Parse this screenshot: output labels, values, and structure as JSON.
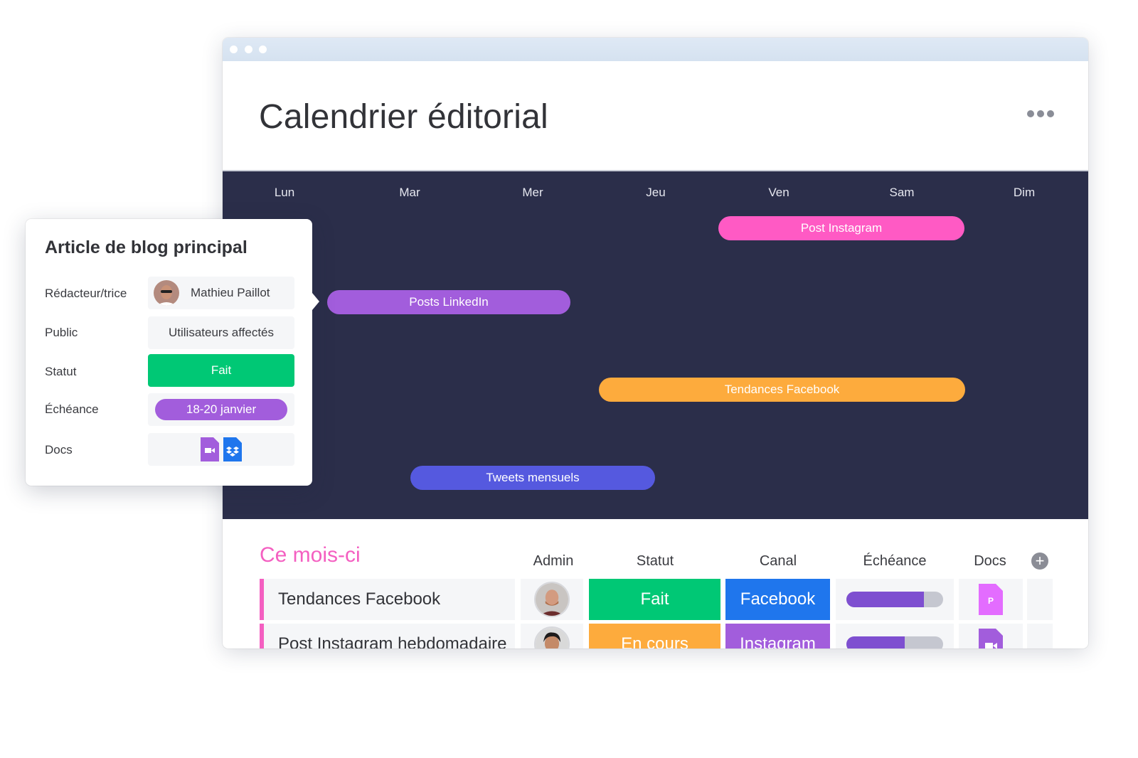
{
  "window": {
    "title": "Calendrier éditorial",
    "more_icon": "more-horizontal-icon"
  },
  "calendar": {
    "days": [
      "Lun",
      "Mar",
      "Mer",
      "Jeu",
      "Ven",
      "Sam",
      "Dim"
    ],
    "events": [
      {
        "label": "Post Instagram",
        "color": "#ff5ac4"
      },
      {
        "label": "Posts LinkedIn",
        "color": "#a25ddc"
      },
      {
        "label": "Tendances Facebook",
        "color": "#fdab3d"
      },
      {
        "label": "Tweets mensuels",
        "color": "#5559df"
      }
    ]
  },
  "board": {
    "group_title": "Ce mois-ci",
    "group_color": "#f45fc1",
    "columns": [
      "Admin",
      "Statut",
      "Canal",
      "Échéance",
      "Docs"
    ],
    "add_column_icon": "plus-icon",
    "rows": [
      {
        "name": "Tendances Facebook",
        "status": "Fait",
        "status_color": "#00c875",
        "canal": "Facebook",
        "canal_color": "#1f76ed",
        "due_progress": 0.8,
        "doc_icon": "ppt-file-icon",
        "doc_letter": "P",
        "doc_color": "#e36cff"
      },
      {
        "name": "Post Instagram hebdomadaire",
        "status": "En cours",
        "status_color": "#fdab3d",
        "canal": "Instagram",
        "canal_color": "#a25ddc",
        "due_progress": 0.6,
        "doc_icon": "video-file-icon",
        "doc_letter": "",
        "doc_color": "#a25ddc"
      }
    ]
  },
  "card": {
    "title": "Article de blog principal",
    "fields": [
      {
        "label": "Rédacteur/trice",
        "value": "Mathieu Paillot"
      },
      {
        "label": "Public",
        "value": "Utilisateurs affectés"
      },
      {
        "label": "Statut",
        "value": "Fait"
      },
      {
        "label": "Échéance",
        "value": "18-20 janvier"
      },
      {
        "label": "Docs",
        "value": ""
      }
    ],
    "docs": [
      "video-file-icon",
      "dropbox-file-icon"
    ]
  }
}
